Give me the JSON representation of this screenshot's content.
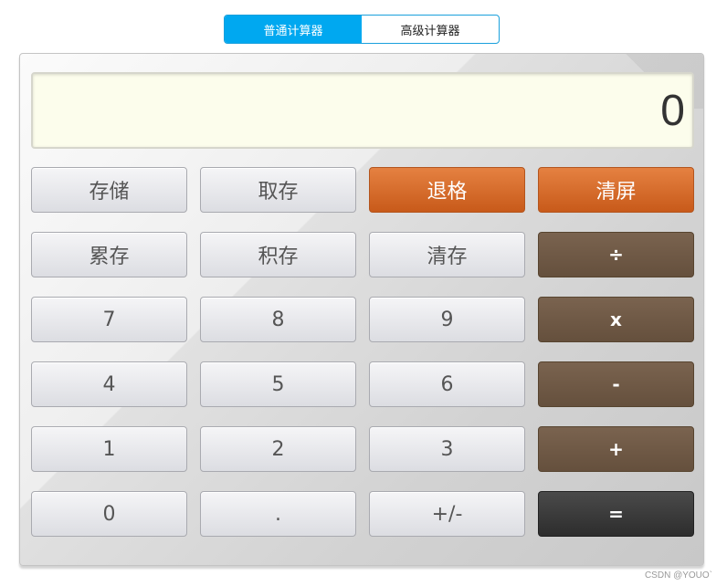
{
  "mode_tabs": {
    "basic": "普通计算器",
    "advanced": "高级计算器",
    "active": "basic"
  },
  "display": {
    "value": "0"
  },
  "keys": {
    "store": "存储",
    "recall": "取存",
    "backspace": "退格",
    "clear": "清屏",
    "add_store": "累存",
    "mul_store": "积存",
    "clear_store": "清存",
    "divide": "÷",
    "seven": "7",
    "eight": "8",
    "nine": "9",
    "multiply": "x",
    "four": "4",
    "five": "5",
    "six": "6",
    "minus": "-",
    "one": "1",
    "two": "2",
    "three": "3",
    "plus": "+",
    "zero": "0",
    "dot": ".",
    "sign": "+/-",
    "equals": "="
  },
  "colors": {
    "tab_active": "#00a8f0",
    "display_bg": "#fcfdec",
    "key_orange": "#d86a2c",
    "key_brown": "#6e5845",
    "key_dark": "#3a3a3a"
  },
  "watermark": "CSDN @YOUO`"
}
